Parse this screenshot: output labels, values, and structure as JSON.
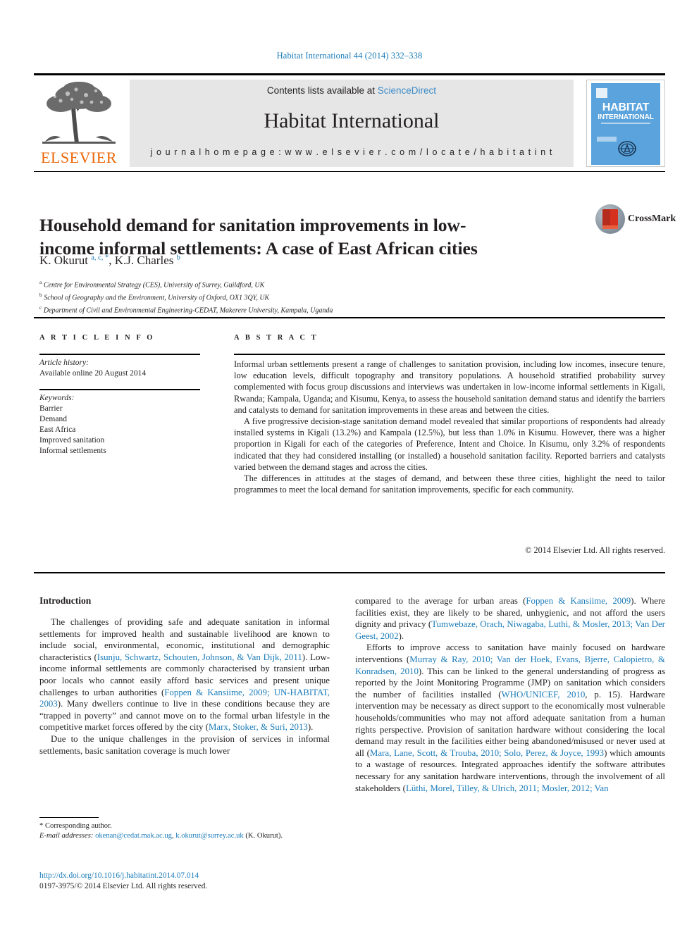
{
  "running_head": "Habitat International 44 (2014) 332–338",
  "masthead": {
    "contents_prefix": "Contents lists available at",
    "sciencedirect": "ScienceDirect",
    "journal_name": "Habitat International",
    "homepage": "j o u r n a l   h o m e p a g e :   w w w . e l s e v i e r . c o m / l o c a t e / h a b i t a t i n t",
    "publisher_wordmark": "ELSEVIER",
    "cover": {
      "line1": "HABITAT",
      "line2": "INTERNATIONAL"
    }
  },
  "article": {
    "title": "Household demand for sanitation improvements in low-income informal settlements: A case of East African cities",
    "authors_html": "K. Okurut <sup>a, c, *</sup>, K.J. Charles <sup>b</sup>",
    "affiliations": [
      {
        "marker": "a",
        "text": "Centre for Environmental Strategy (CES), University of Surrey, Guildford, UK"
      },
      {
        "marker": "b",
        "text": "School of Geography and the Environment, University of Oxford, OX1 3QY, UK"
      },
      {
        "marker": "c",
        "text": "Department of Civil and Environmental Engineering-CEDAT, Makerere University, Kampala, Uganda"
      }
    ],
    "crossmark_label": "CrossMark"
  },
  "info": {
    "heading": "A R T I C L E   I N F O",
    "history_label": "Article history:",
    "history_value": "Available online 20 August 2014",
    "keywords_label": "Keywords:",
    "keywords": [
      "Barrier",
      "Demand",
      "East Africa",
      "Improved sanitation",
      "Informal settlements"
    ]
  },
  "abstract": {
    "heading": "A B S T R A C T",
    "paragraphs": [
      "Informal urban settlements present a range of challenges to sanitation provision, including low incomes, insecure tenure, low education levels, difficult topography and transitory populations. A household stratified probability survey complemented with focus group discussions and interviews was undertaken in low-income informal settlements in Kigali, Rwanda; Kampala, Uganda; and Kisumu, Kenya, to assess the household sanitation demand status and identify the barriers and catalysts to demand for sanitation improvements in these areas and between the cities.",
      "A five progressive decision-stage sanitation demand model revealed that similar proportions of respondents had already installed systems in Kigali (13.2%) and Kampala (12.5%), but less than 1.0% in Kisumu. However, there was a higher proportion in Kigali for each of the categories of Preference, Intent and Choice. In Kisumu, only 3.2% of respondents indicated that they had considered installing (or installed) a household sanitation facility. Reported barriers and catalysts varied between the demand stages and across the cities.",
      "The differences in attitudes at the stages of demand, and between these three cities, highlight the need to tailor programmes to meet the local demand for sanitation improvements, specific for each community."
    ],
    "copyright": "© 2014 Elsevier Ltd. All rights reserved."
  },
  "body": {
    "section_heading": "Introduction",
    "left_paragraphs": [
      "The challenges of providing safe and adequate sanitation in informal settlements for improved health and sustainable livelihood are known to include social, environmental, economic, institutional and demographic characteristics (",
      "Due to the unique challenges in the provision of services in informal settlements, basic sanitation coverage is much lower"
    ],
    "refs": {
      "isunju": "Isunju, Schwartz, Schouten, Johnson, & Van Dijk, 2011",
      "foppen_unhabitat": "Foppen & Kansiime, 2009; UN-HABITAT, 2003",
      "marx": "Marx, Stoker, & Suri, 2013",
      "foppen": "Foppen & Kansiime, 2009",
      "tumwebaze": "Tumwebaze, Orach, Niwagaba, Luthi, & Mosler, 2013; Van Der Geest, 2002",
      "murray": "Murray & Ray, 2010; Van der Hoek, Evans, Bjerre, Calopietro, & Konradsen, 2010",
      "who": "WHO/UNICEF, 2010",
      "mara": "Mara, Lane, Scott, & Trouba, 2010; Solo, Perez, & Joyce, 1993",
      "luthi": "Lüthi, Morel, Tilley, & Ulrich, 2011; Mosler, 2012; Van"
    },
    "left_p1_tail": "). Low-income informal settlements are commonly characterised by transient urban poor locals who cannot easily afford basic services and present unique challenges to urban authorities (",
    "left_p1_tail2": "). Many dwellers continue to live in these conditions because they are “trapped in poverty” and cannot move on to the formal urban lifestyle in the competitive market forces offered by the city (",
    "left_p1_tail3": ").",
    "right_p1_head": "compared to the average for urban areas (",
    "right_p1_mid": "). Where facilities exist, they are likely to be shared, unhygienic, and not afford the users dignity and privacy (",
    "right_p1_tail": ").",
    "right_p2_head": "Efforts to improve access to sanitation have mainly focused on hardware interventions (",
    "right_p2_mid1": "). This can be linked to the general understanding of progress as reported by the Joint Monitoring Programme (JMP) on sanitation which considers the number of facilities installed (",
    "right_p2_mid2": ", p. 15). Hardware intervention may be necessary as direct support to the economically most vulnerable households/communities who may not afford adequate sanitation from a human rights perspective. Provision of sanitation hardware without considering the local demand may result in the facilities either being abandoned/misused or never used at all (",
    "right_p2_mid3": ") which amounts to a wastage of resources. Integrated approaches identify the software attributes necessary for any sanitation hardware interventions, through the involvement of all stakeholders ("
  },
  "footer": {
    "corresponding_marker": "*",
    "corresponding_text": "Corresponding author.",
    "email_label": "E-mail addresses:",
    "email1": "okenan@cedat.mak.ac.ug",
    "email_sep": ", ",
    "email2": "k.okurut@surrey.ac.uk",
    "email_suffix": " (K. Okurut).",
    "doi": "http://dx.doi.org/10.1016/j.habitatint.2014.07.014",
    "issn_line": "0197-3975/© 2014 Elsevier Ltd. All rights reserved."
  }
}
